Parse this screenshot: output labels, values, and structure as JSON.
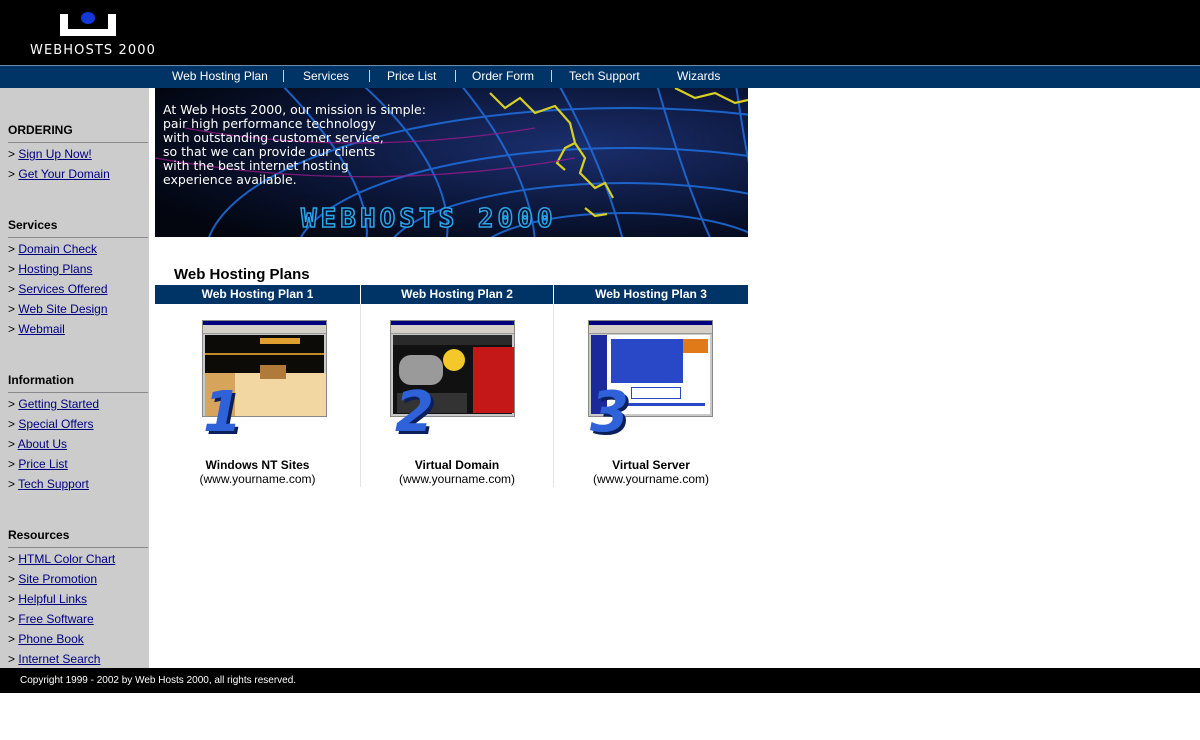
{
  "header": {
    "logo_text": "WEBHOSTS 2000"
  },
  "nav": {
    "items": [
      {
        "label": "Web Hosting Plan"
      },
      {
        "label": "Services"
      },
      {
        "label": "Price List"
      },
      {
        "label": "Order Form"
      },
      {
        "label": "Tech Support"
      },
      {
        "label": "Wizards"
      }
    ]
  },
  "sidebar": {
    "groups": [
      {
        "heading": "ORDERING",
        "links": [
          "Sign Up Now!",
          "Get Your Domain"
        ]
      },
      {
        "heading": "Services",
        "links": [
          "Domain Check",
          "Hosting Plans",
          "Services Offered",
          "Web Site Design",
          "Webmail"
        ]
      },
      {
        "heading": "Information",
        "links": [
          "Getting Started",
          "Special Offers",
          "About Us",
          "Price List",
          "Tech Support"
        ]
      },
      {
        "heading": "Resources",
        "links": [
          "HTML Color Chart",
          "Site Promotion",
          "Helpful Links",
          "Free Software",
          "Phone Book",
          "Internet Search"
        ]
      }
    ],
    "arrow": ">"
  },
  "banner": {
    "mission_lines": [
      "At Web Hosts 2000, our mission is simple:",
      "pair high performance technology",
      "with outstanding customer service,",
      "so that we can provide our clients",
      "with the best internet hosting",
      "experience available."
    ],
    "logo_text": "WEBHOSTS 2000"
  },
  "plans": {
    "title": "Web Hosting Plans",
    "items": [
      {
        "header": "Web Hosting Plan 1",
        "number": "1",
        "name": "Windows NT Sites",
        "domain": "(www.yourname.com)"
      },
      {
        "header": "Web Hosting Plan 2",
        "number": "2",
        "name": "Virtual Domain",
        "domain": "(www.yourname.com)"
      },
      {
        "header": "Web Hosting Plan 3",
        "number": "3",
        "name": "Virtual Server",
        "domain": "(www.yourname.com)"
      }
    ]
  },
  "footer": {
    "copyright": "Copyright 1999 - 2002 by Web Hosts 2000, all rights reserved."
  },
  "colors": {
    "nav_bg": "#003366",
    "header_bg": "#000000",
    "sidebar_bg": "#cccccc",
    "link": "#000080",
    "plan_number": "#2f62d8"
  }
}
